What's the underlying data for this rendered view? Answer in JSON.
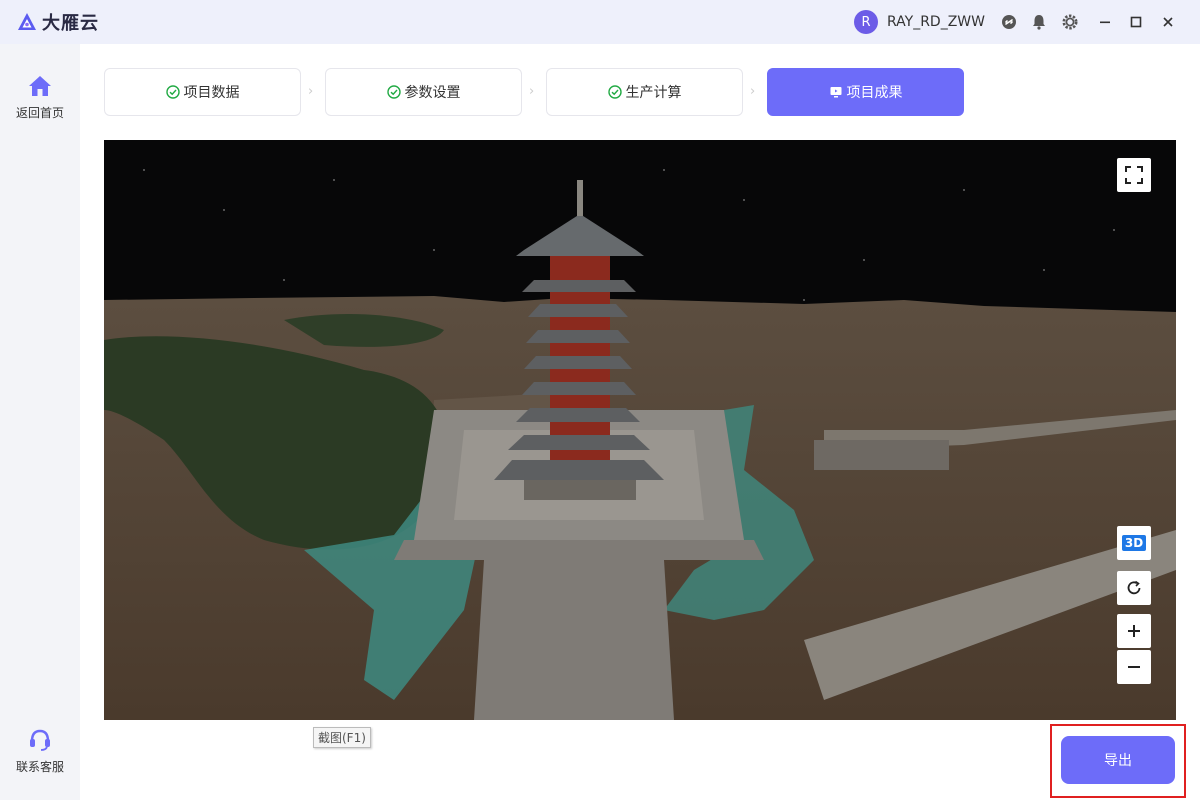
{
  "app": {
    "name": "大雁云"
  },
  "user": {
    "avatar_letter": "R",
    "name": "RAY_RD_ZWW"
  },
  "sidebar": {
    "home_label": "返回首页",
    "support_label": "联系客服"
  },
  "steps": [
    {
      "label": "项目数据",
      "status": "done"
    },
    {
      "label": "参数设置",
      "status": "done"
    },
    {
      "label": "生产计算",
      "status": "done"
    },
    {
      "label": "项目成果",
      "status": "active"
    }
  ],
  "viewer": {
    "buttons": [
      "fullscreen-icon",
      "3d-toggle",
      "rotate-icon",
      "zoom-in-icon",
      "zoom-out-icon"
    ],
    "badge_3d": "3D"
  },
  "tooltip": "截图(F1)",
  "actions": {
    "export_label": "导出"
  },
  "colors": {
    "accent": "#6d6cf9",
    "highlight": "#e02020",
    "check": "#22aa44"
  }
}
